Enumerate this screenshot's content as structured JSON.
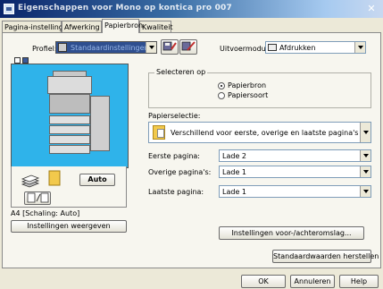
{
  "window": {
    "title": "Eigenschappen voor Mono op kontica pro 007",
    "close_glyph": "✕"
  },
  "tabs": [
    {
      "label": "Pagina-instelling",
      "active": false
    },
    {
      "label": "Afwerking",
      "active": false
    },
    {
      "label": "Papierbron",
      "active": true
    },
    {
      "label": "Kwaliteit",
      "active": false
    }
  ],
  "profile": {
    "label": "Profiel:",
    "value": "Standaardinstellingen",
    "output_mode_label": "Uitvoermodus:",
    "output_mode_value": "Afdrukken"
  },
  "select_on": {
    "title": "Selecteren op",
    "options": [
      {
        "label": "Papierbron",
        "selected": true
      },
      {
        "label": "Papiersoort",
        "selected": false
      }
    ]
  },
  "paper_selection": {
    "label": "Papierselectie:",
    "value": "Verschillend voor eerste, overige en laatste pagina's"
  },
  "fields": [
    {
      "label": "Eerste pagina:",
      "value": "Lade 2"
    },
    {
      "label": "Overige pagina's:",
      "value": "Lade 1"
    },
    {
      "label": "Laatste pagina:",
      "value": "Lade 1"
    }
  ],
  "preview": {
    "auto_label": "Auto",
    "status": "A4 [Schaling: Auto]",
    "show_settings_button": "Instellingen weergeven"
  },
  "buttons": {
    "front_back_cover": "Instellingen voor-/achteromslag...",
    "restore_defaults": "Standaardwaarden herstellen",
    "ok": "OK",
    "cancel": "Annuleren",
    "help": "Help"
  },
  "colors": {
    "preview_background": "#2fb3ea",
    "title_bar": "#0a246a"
  }
}
